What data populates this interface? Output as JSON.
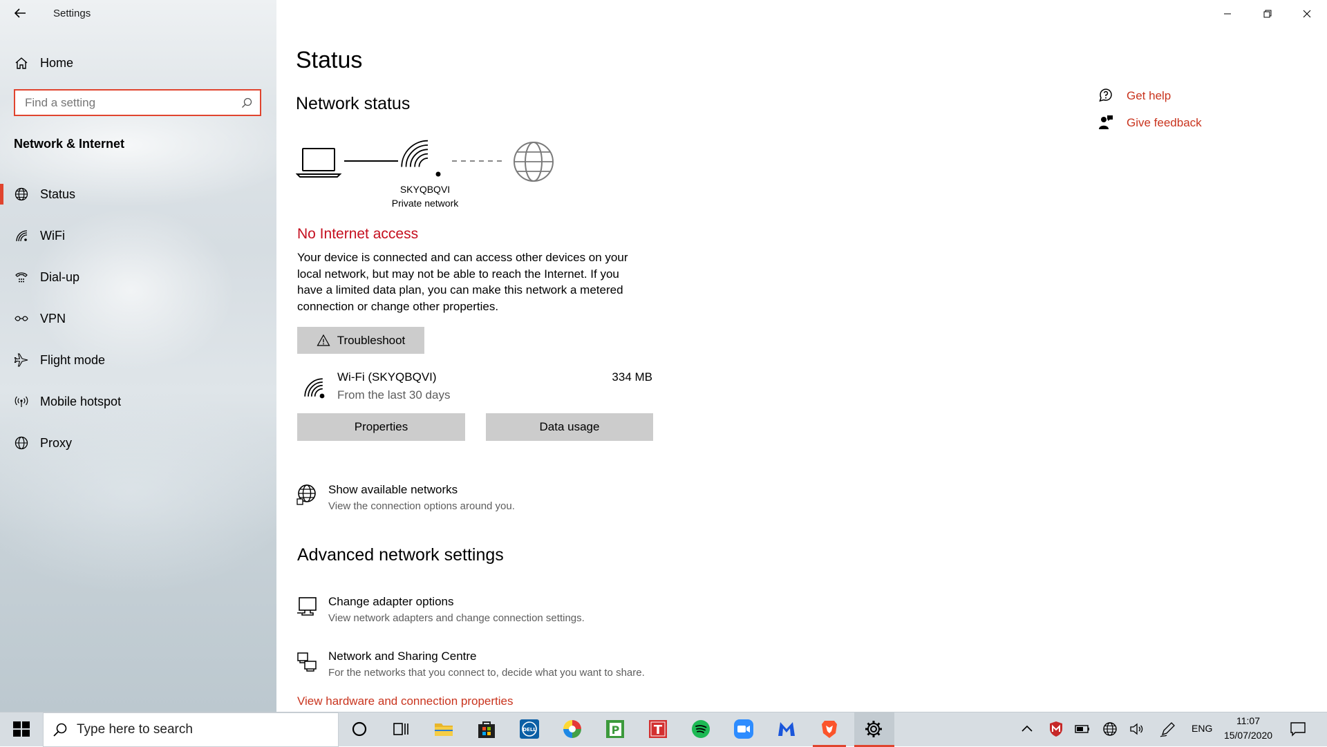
{
  "window": {
    "title": "Settings"
  },
  "sidebar": {
    "home_label": "Home",
    "search_placeholder": "Find a setting",
    "section_title": "Network & Internet",
    "items": [
      {
        "label": "Status",
        "icon": "globe-icon",
        "active": true
      },
      {
        "label": "WiFi",
        "icon": "wifi-icon"
      },
      {
        "label": "Dial-up",
        "icon": "dialup-icon"
      },
      {
        "label": "VPN",
        "icon": "vpn-icon"
      },
      {
        "label": "Flight mode",
        "icon": "airplane-icon"
      },
      {
        "label": "Mobile hotspot",
        "icon": "hotspot-icon"
      },
      {
        "label": "Proxy",
        "icon": "globe-icon"
      }
    ]
  },
  "main": {
    "title": "Status",
    "network_status_heading": "Network status",
    "network": {
      "name": "SKYQBQVI",
      "type": "Private network"
    },
    "error_title": "No Internet access",
    "error_desc": "Your device is connected and can access other devices on your local network, but may not be able to reach the Internet. If you have a limited data plan, you can make this network a metered connection or change other properties.",
    "troubleshoot_label": "Troubleshoot",
    "wifi": {
      "name": "Wi-Fi (SKYQBQVI)",
      "period": "From the last 30 days",
      "usage": "334 MB"
    },
    "properties_label": "Properties",
    "data_usage_label": "Data usage",
    "show_networks": {
      "title": "Show available networks",
      "subtitle": "View the connection options around you."
    },
    "advanced_heading": "Advanced network settings",
    "change_adapter": {
      "title": "Change adapter options",
      "subtitle": "View network adapters and change connection settings."
    },
    "sharing_centre": {
      "title": "Network and Sharing Centre",
      "subtitle": "For the networks that you connect to, decide what you want to share."
    },
    "hardware_link": "View hardware and connection properties"
  },
  "help": {
    "get_help": "Get help",
    "give_feedback": "Give feedback"
  },
  "taskbar": {
    "search_placeholder": "Type here to search",
    "language": "ENG",
    "time": "11:07",
    "date": "15/07/2020"
  },
  "colors": {
    "accent": "#e0442e",
    "error": "#c50f1f",
    "link": "#c9341e"
  }
}
